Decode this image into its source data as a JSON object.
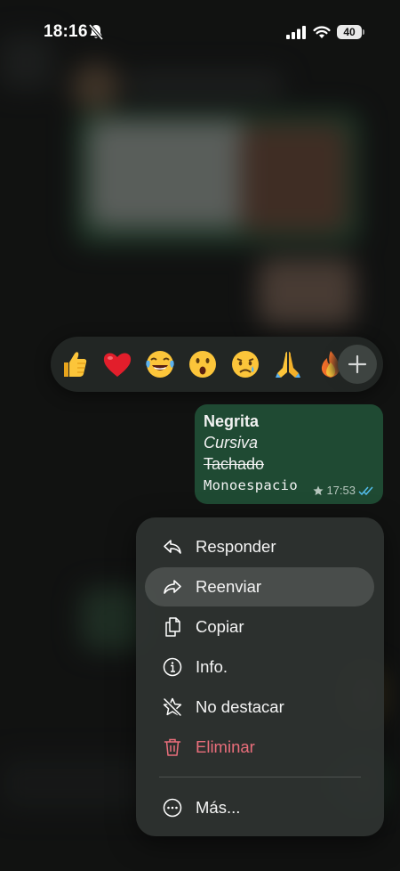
{
  "status_bar": {
    "time": "18:16",
    "battery": "40"
  },
  "reactions": {
    "emojis": [
      "thumbs-up",
      "red-heart",
      "tears-of-joy",
      "face-open-mouth",
      "crying-face",
      "folded-hands",
      "fire"
    ]
  },
  "message": {
    "lines": [
      "Negrita",
      "Cursiva",
      "Tachado",
      "Monoespacio"
    ],
    "time": "17:53",
    "starred": true,
    "read_status": "double-check-blue",
    "bubble_color": "#1f4a33"
  },
  "menu": {
    "items": [
      {
        "label": "Responder",
        "icon": "reply-icon"
      },
      {
        "label": "Reenviar",
        "icon": "forward-icon"
      },
      {
        "label": "Copiar",
        "icon": "copy-icon"
      },
      {
        "label": "Info.",
        "icon": "info-icon"
      },
      {
        "label": "No destacar",
        "icon": "unstar-icon"
      },
      {
        "label": "Eliminar",
        "icon": "trash-icon"
      },
      {
        "label": "Más...",
        "icon": "more-icon"
      }
    ],
    "danger_color": "#ea6e7b"
  }
}
